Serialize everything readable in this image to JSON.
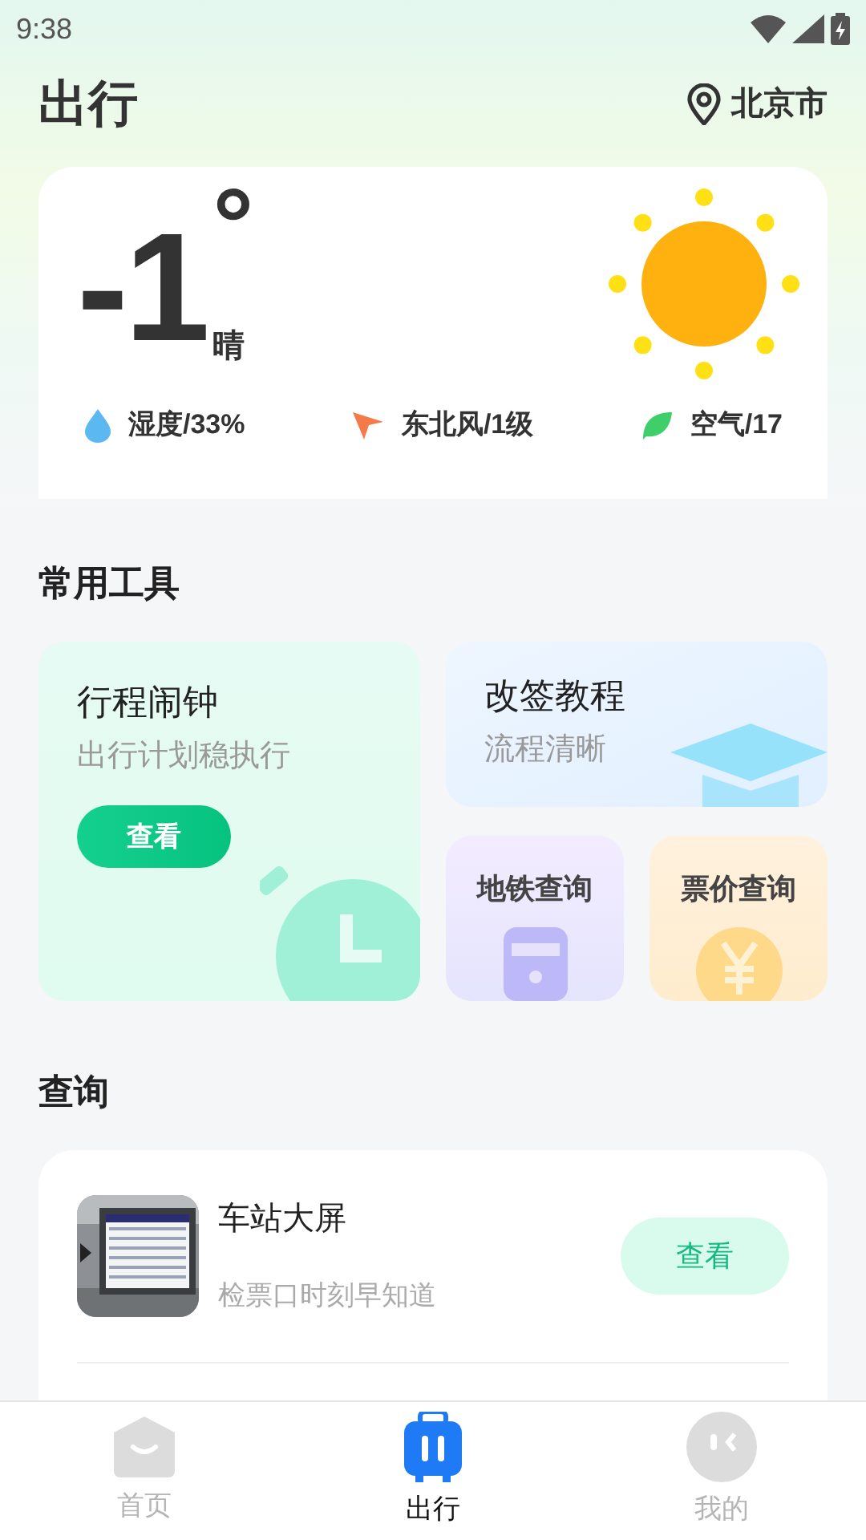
{
  "status_bar": {
    "time": "9:38"
  },
  "header": {
    "title": "出行",
    "location": "北京市"
  },
  "weather": {
    "temperature": "-1",
    "degree": "°",
    "condition": "晴",
    "stats": [
      {
        "kind": "humidity",
        "text": "湿度/33%"
      },
      {
        "kind": "wind",
        "text": "东北风/1级"
      },
      {
        "kind": "air",
        "text": "空气/17"
      }
    ]
  },
  "tools": {
    "title": "常用工具",
    "items": [
      {
        "kind": "alarm",
        "title": "行程闹钟",
        "subtitle": "出行计划稳执行",
        "button": "查看"
      },
      {
        "kind": "tutorial",
        "title": "改签教程",
        "subtitle": "流程清晰"
      },
      {
        "kind": "metro",
        "title": "地铁查询"
      },
      {
        "kind": "fare",
        "title": "票价查询"
      }
    ]
  },
  "query": {
    "title": "查询",
    "items": [
      {
        "title": "车站大屏",
        "subtitle": "检票口时刻早知道",
        "button": "查看"
      }
    ]
  },
  "bottom_nav": [
    {
      "kind": "home",
      "label": "首页",
      "selected": false
    },
    {
      "kind": "travel",
      "label": "出行",
      "selected": true
    },
    {
      "kind": "profile",
      "label": "我的",
      "selected": false
    }
  ]
}
